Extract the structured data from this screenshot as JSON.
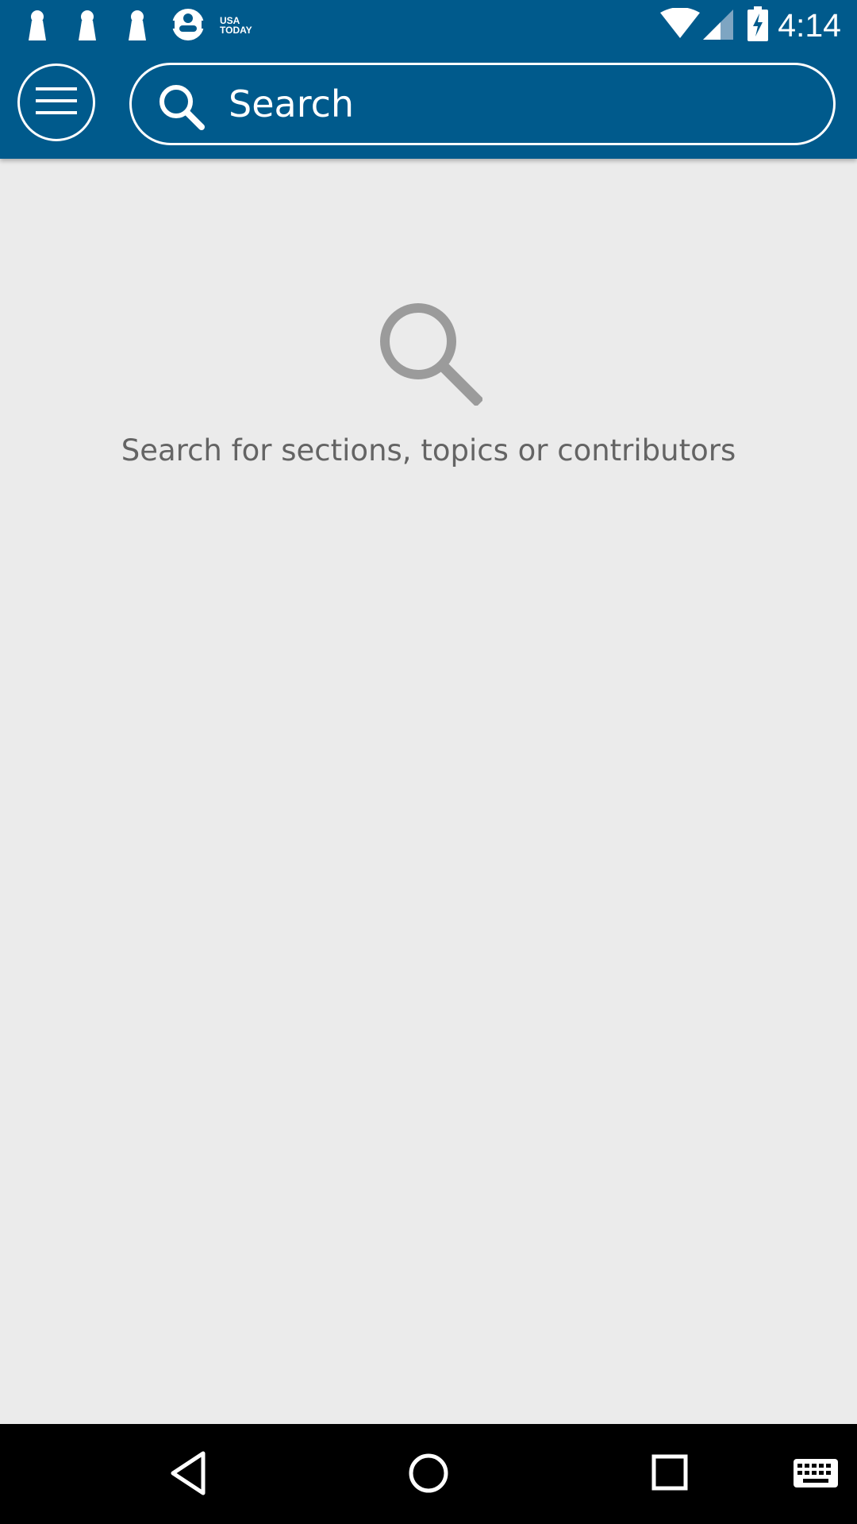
{
  "status_bar": {
    "time": "4:14",
    "notification_icons": [
      "notification-app-icon",
      "notification-app-icon",
      "notification-app-icon",
      "notification-app-icon"
    ],
    "usa_today_label_line1": "USA",
    "usa_today_label_line2": "TODAY",
    "status_icons": [
      "wifi-icon",
      "cell-signal-icon",
      "battery-charging-icon"
    ]
  },
  "toolbar": {
    "menu_icon": "hamburger-menu-icon",
    "search_icon": "search-icon",
    "search_placeholder": "Search",
    "search_value": ""
  },
  "empty_state": {
    "icon": "search-icon",
    "message": "Search for sections, topics or contributors"
  },
  "nav_bar": {
    "buttons": [
      "back-icon",
      "home-icon",
      "recents-icon",
      "keyboard-icon"
    ]
  },
  "colors": {
    "header": "#005a8c",
    "background": "#ebebeb",
    "empty_icon": "#9b9b9b",
    "empty_text": "#646464",
    "nav_bar": "#000000"
  }
}
